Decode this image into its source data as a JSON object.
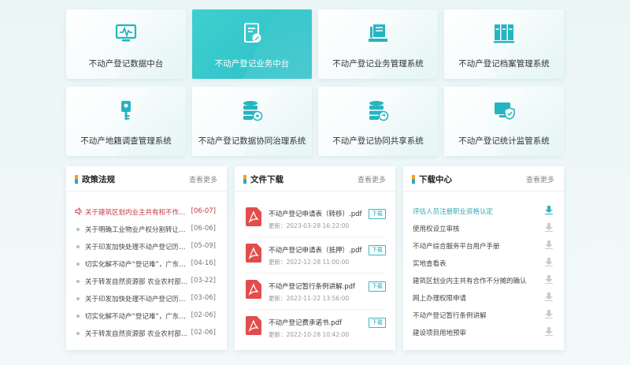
{
  "tiles": [
    {
      "label": "不动产登记数据中台",
      "icon": "monitor-pulse-icon",
      "active": false
    },
    {
      "label": "不动产登记业务中台",
      "icon": "document-edit-icon",
      "active": true
    },
    {
      "label": "不动产登记业务管理系统",
      "icon": "book-stand-icon",
      "active": false
    },
    {
      "label": "不动产登记档案管理系统",
      "icon": "archive-cabinet-icon",
      "active": false
    },
    {
      "label": "不动产地籍调查管理系统",
      "icon": "key-tag-icon",
      "active": false
    },
    {
      "label": "不动产登记数据协同治理系统",
      "icon": "database-gear-icon",
      "active": false
    },
    {
      "label": "不动产登记协同共享系统",
      "icon": "database-sync-icon",
      "active": false
    },
    {
      "label": "不动产登记统计监管系统",
      "icon": "monitor-shield-icon",
      "active": false
    }
  ],
  "policy": {
    "title": "政策法规",
    "more": "查看更多",
    "items": [
      {
        "text": "关于建筑区划内业主共有和不作分摊...",
        "date": "[06-07]",
        "hot": true
      },
      {
        "text": "关于明确工业物业产权分割转让工...",
        "date": "[06-06]",
        "hot": false
      },
      {
        "text": "关于印发加快处理不动产登记历史遗...",
        "date": "[05-09]",
        "hot": false
      },
      {
        "text": "切实化解不动产“登记难”，广东发...",
        "date": "[04-16]",
        "hot": false
      },
      {
        "text": "关于转发自然资源部 农业农村部做好...",
        "date": "[03-22]",
        "hot": false
      },
      {
        "text": "关于印发加快处理不动产登记历史遗...",
        "date": "[03-06]",
        "hot": false
      },
      {
        "text": "切实化解不动产“登记难”，广东发...",
        "date": "[02-06]",
        "hot": false
      },
      {
        "text": "关于转发自然资源部 农业农村部做好...",
        "date": "[02-06]",
        "hot": false
      }
    ]
  },
  "files": {
    "title": "文件下载",
    "more": "查看更多",
    "download_label": "下载",
    "items": [
      {
        "name": "不动产登记申请表（转移）.pdf",
        "date": "更新：2023-03-28 16:22:00"
      },
      {
        "name": "不动产登记申请表（抵押）.pdf",
        "date": "更新：2022-12-28 11:00:00"
      },
      {
        "name": "不动产登记暂行条例讲解.pdf",
        "date": "更新：2022-11-22 13:56:00"
      },
      {
        "name": "不动产登记费承诺书.pdf",
        "date": "更新：2022-10-28 10:42:00"
      }
    ]
  },
  "downloads": {
    "title": "下载中心",
    "more": "查看更多",
    "items": [
      "评估人员注册职业资格认定",
      "使用权设立审核",
      "不动产综合服务平台用户手册",
      "实地查看表",
      "建筑区划业内主共有合作不分摊的确认",
      "网上办理权限申请",
      "不动产登记暂行条例讲解",
      "建设项目用地预审"
    ]
  },
  "colors": {
    "accent": "#2bbfc7",
    "hot": "#c8373d",
    "pdf": "#e24c4b"
  }
}
